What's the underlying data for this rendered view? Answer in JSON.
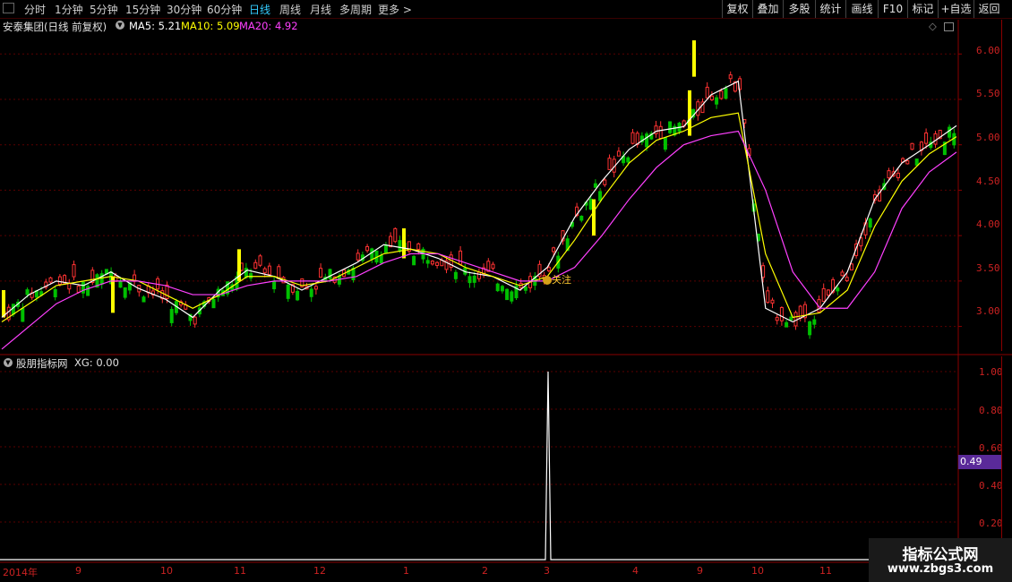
{
  "periods": [
    "分时",
    "1分钟",
    "5分钟",
    "15分钟",
    "30分钟",
    "60分钟",
    "日线",
    "周线",
    "月线",
    "多周期",
    "更多 >"
  ],
  "active_period": "日线",
  "toolbar_buttons": [
    "复权",
    "叠加",
    "多股",
    "统计",
    "画线",
    "F10",
    "标记",
    "+自选",
    "返回"
  ],
  "main_panel": {
    "title": "安泰集团(日线 前复权)",
    "ma5_label": "MA5: 5.21",
    "ma10_label": "MA10: 5.09",
    "ma20_label": "MA20: 4.92",
    "price_ticks": [
      "6.00",
      "5.50",
      "5.00",
      "4.50",
      "4.00",
      "3.50",
      "3.00"
    ],
    "follow_label": "关注"
  },
  "sub_panel": {
    "title": "股朋指标网",
    "xg_label": "XG: 0.00",
    "ticks": [
      "1.00",
      "0.80",
      "0.60",
      "0.40",
      "0.20"
    ],
    "current_value": "0.49"
  },
  "x_axis": [
    "2014年",
    "9",
    "10",
    "11",
    "12",
    "1",
    "2",
    "3",
    "4",
    "9",
    "10",
    "11"
  ],
  "colors": {
    "up": "#ff3232",
    "down": "#00c000",
    "ma5": "#ffffff",
    "ma10": "#ffff00",
    "ma20": "#ff40ff",
    "grid": "#5a0000",
    "axis": "#8a0000"
  },
  "chart_data": {
    "type": "candlestick",
    "ylim": [
      2.7,
      6.2
    ],
    "series": [
      {
        "name": "MA5",
        "values": [
          3.1,
          3.35,
          3.5,
          3.45,
          3.6,
          3.42,
          3.3,
          3.1,
          3.4,
          3.62,
          3.55,
          3.4,
          3.55,
          3.7,
          3.9,
          3.85,
          3.75,
          3.6,
          3.55,
          3.4,
          3.65,
          4.2,
          4.6,
          4.95,
          5.15,
          5.2,
          5.55,
          5.7,
          3.2,
          3.05,
          3.2,
          3.6,
          4.4,
          4.8,
          5.0,
          5.21
        ]
      },
      {
        "name": "MA10",
        "values": [
          3.05,
          3.25,
          3.45,
          3.5,
          3.55,
          3.5,
          3.35,
          3.2,
          3.35,
          3.55,
          3.55,
          3.45,
          3.5,
          3.65,
          3.8,
          3.85,
          3.8,
          3.65,
          3.55,
          3.45,
          3.55,
          3.95,
          4.4,
          4.8,
          5.05,
          5.15,
          5.3,
          5.35,
          3.8,
          3.1,
          3.15,
          3.4,
          4.1,
          4.6,
          4.9,
          5.09
        ]
      },
      {
        "name": "MA20",
        "values": [
          2.75,
          3.0,
          3.25,
          3.4,
          3.5,
          3.5,
          3.45,
          3.35,
          3.35,
          3.45,
          3.5,
          3.5,
          3.5,
          3.55,
          3.7,
          3.8,
          3.8,
          3.7,
          3.6,
          3.5,
          3.5,
          3.65,
          4.0,
          4.4,
          4.75,
          5.0,
          5.1,
          5.15,
          4.5,
          3.6,
          3.2,
          3.2,
          3.6,
          4.3,
          4.7,
          4.92
        ]
      },
      {
        "name": "XG",
        "values": [
          0,
          0,
          0,
          0,
          0,
          0,
          0,
          0,
          0,
          0,
          0,
          0,
          0,
          0,
          0,
          0,
          0,
          0,
          0,
          0,
          0,
          1,
          0,
          0,
          0,
          0,
          0,
          0,
          0,
          0,
          0,
          0,
          0,
          0,
          0,
          0
        ]
      }
    ]
  }
}
